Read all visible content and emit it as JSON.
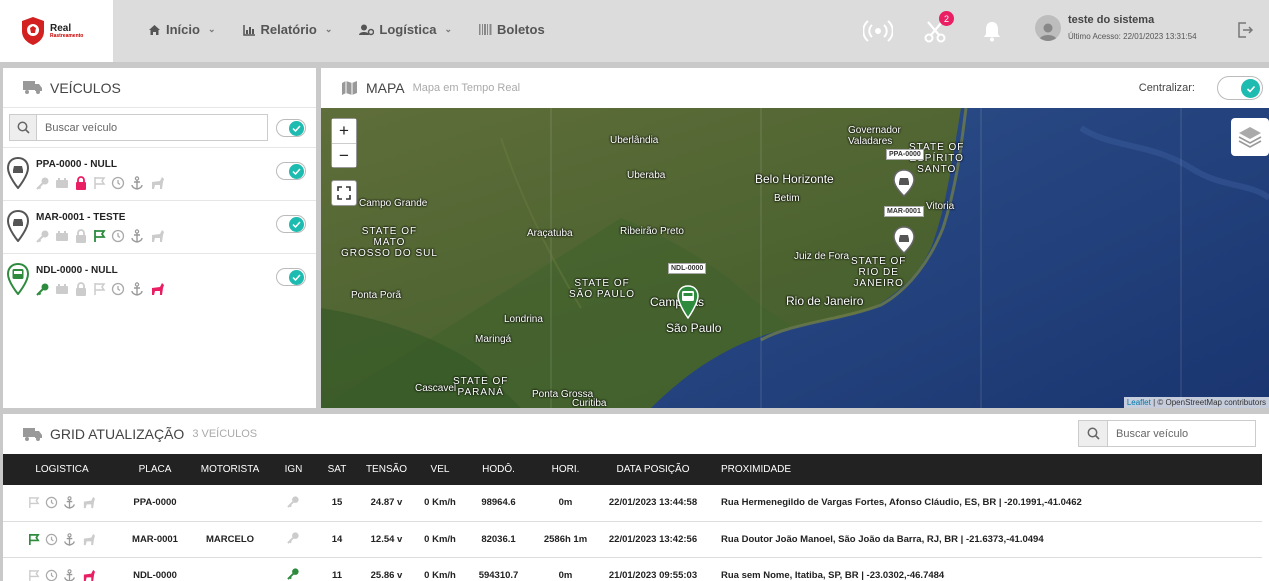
{
  "brand": {
    "line1": "Real",
    "line2": "Rastreamento"
  },
  "nav": [
    {
      "label": "Início",
      "icon": "home-icon"
    },
    {
      "label": "Relatório",
      "icon": "chart-icon"
    },
    {
      "label": "Logística",
      "icon": "user-gear-icon"
    },
    {
      "label": "Boletos",
      "icon": "barcode-icon"
    }
  ],
  "notifications": {
    "badge": "2"
  },
  "user": {
    "name": "teste do sistema",
    "last_access": "Último Acesso: 22/01/2023 13:31:54"
  },
  "vehicles_panel": {
    "title": "VEÍCULOS",
    "search_placeholder": "Buscar veículo",
    "items": [
      {
        "name": "PPA-0000 - NULL"
      },
      {
        "name": "MAR-0001 - TESTE"
      },
      {
        "name": "NDL-0000 - NULL"
      }
    ]
  },
  "map_panel": {
    "title": "MAPA",
    "subtitle": "Mapa em Tempo Real",
    "center_label": "Centralizar:",
    "zoom_in": "+",
    "zoom_out": "−",
    "attribution_link": "Leaflet",
    "attribution_text": " | © OpenStreetMap contributors",
    "labels": {
      "uberlandia": "Uberlândia",
      "uberaba": "Uberaba",
      "gov_valadares": "Governador\nValadares",
      "belo_horizonte": "Belo Horizonte",
      "betim": "Betim",
      "vitoria": "Vitoria",
      "campo_grande": "Campo Grande",
      "aracatuba": "Araçatuba",
      "ribeirao_preto": "Ribeirão Preto",
      "juiz_de_fora": "Juiz de Fora",
      "ponta_pora": "Ponta Porã",
      "campinas": "Campinas",
      "sao_paulo": "São Paulo",
      "rio_de_janeiro": "Rio de Janeiro",
      "londrina": "Londrina",
      "maringa": "Maringá",
      "cascavel": "Cascavel",
      "ponta_grossa": "Ponta Grossa",
      "curitiba": "Curitiba",
      "state_ms": "STATE OF\nMATO\nGROSSO DO SUL",
      "state_sp": "STATE OF\nSÃO PAULO",
      "state_rj": "STATE OF\nRIO DE\nJANEIRO",
      "state_es": "STATE OF\nESPÍRITO\nSANTO",
      "state_pr": "STATE OF\nPARANÁ"
    },
    "markers": [
      {
        "tag": "PPA-0000"
      },
      {
        "tag": "MAR-0001"
      },
      {
        "tag": "NDL-0000"
      }
    ]
  },
  "grid_panel": {
    "title": "GRID ATUALIZAÇÃO",
    "count": "3 VEÍCULOS",
    "search_placeholder": "Buscar veículo",
    "columns": [
      "LOGISTICA",
      "PLACA",
      "MOTORISTA",
      "IGN",
      "SAT",
      "TENSÃO",
      "VEL",
      "HODÔ.",
      "HORI.",
      "DATA POSIÇÃO",
      "PROXIMIDADE"
    ],
    "rows": [
      {
        "placa": "PPA-0000",
        "motorista": "",
        "sat": "15",
        "tensao": "24.87 v",
        "vel": "0 Km/h",
        "hodo": "98964.6",
        "hori": "0m",
        "data": "22/01/2023 13:44:58",
        "prox": "Rua Hermenegildo de Vargas Fortes, Afonso Cláudio, ES, BR | -20.1991,-41.0462"
      },
      {
        "placa": "MAR-0001",
        "motorista": "MARCELO",
        "sat": "14",
        "tensao": "12.54 v",
        "vel": "0 Km/h",
        "hodo": "82036.1",
        "hori": "2586h 1m",
        "data": "22/01/2023 13:42:56",
        "prox": "Rua Doutor João Manoel, São João da Barra, RJ, BR | -21.6373,-41.0494"
      },
      {
        "placa": "NDL-0000",
        "motorista": "",
        "sat": "11",
        "tensao": "25.86 v",
        "vel": "0 Km/h",
        "hodo": "594310.7",
        "hori": "0m",
        "data": "21/01/2023 09:55:03",
        "prox": "Rua sem Nome, Itatiba, SP, BR | -23.0302,-46.7484"
      }
    ]
  },
  "colors": {
    "accent": "#1ebbb0",
    "alert_pink": "#e91e63",
    "active_green": "#2e8b3e",
    "dark_header": "#222222"
  }
}
